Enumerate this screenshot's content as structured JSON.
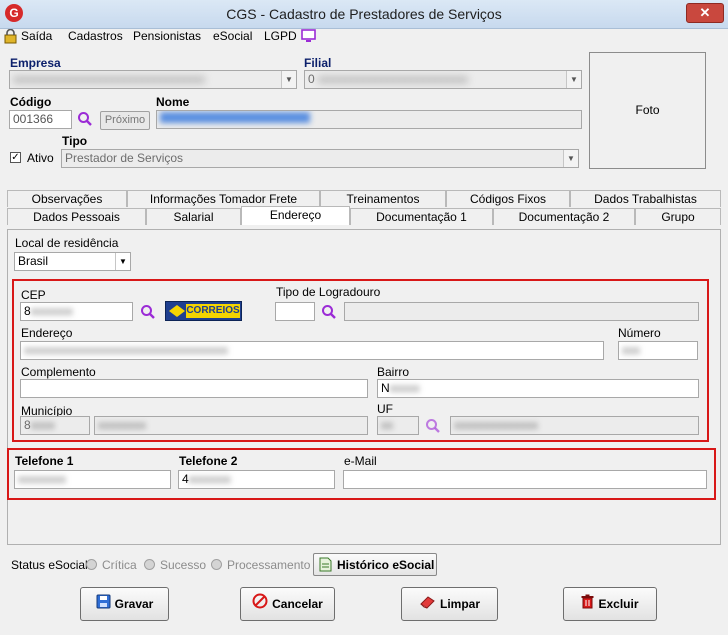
{
  "window": {
    "title": "CGS - Cadastro de Prestadores de Serviços",
    "close_label": "✕",
    "app_icon": "G"
  },
  "menu": {
    "saida": "Saída",
    "cadastros": "Cadastros",
    "pensionistas": "Pensionistas",
    "esocial": "eSocial",
    "lgpd": "LGPD"
  },
  "header": {
    "empresa_label": "Empresa",
    "empresa_value": "",
    "filial_label": "Filial",
    "filial_value": "0",
    "codigo_label": "Código",
    "codigo_value": "001366",
    "proximo_label": "Próximo",
    "nome_label": "Nome",
    "nome_value": "",
    "ativo_label": "Ativo",
    "ativo_checked": "✓",
    "tipo_label": "Tipo",
    "tipo_value": "Prestador de Serviços",
    "foto_label": "Foto"
  },
  "tabs_row1": [
    "Observações",
    "Informações Tomador Frete",
    "Treinamentos",
    "Códigos Fixos",
    "Dados Trabalhistas"
  ],
  "tabs_row2": [
    "Dados Pessoais",
    "Salarial",
    "Endereço",
    "Documentação 1",
    "Documentação 2",
    "Grupo"
  ],
  "endereco": {
    "local_label": "Local de residência",
    "local_value": "Brasil",
    "cep_label": "CEP",
    "cep_value": "8",
    "correios_label": "CORREIOS",
    "tipo_logradouro_label": "Tipo de Logradouro",
    "endereco_label": "Endereço",
    "numero_label": "Número",
    "complemento_label": "Complemento",
    "bairro_label": "Bairro",
    "bairro_value": "N",
    "municipio_label": "Município",
    "municipio_value": "8",
    "uf_label": "UF",
    "telefone1_label": "Telefone 1",
    "telefone2_label": "Telefone 2",
    "telefone2_value": "4",
    "email_label": "e-Mail"
  },
  "status": {
    "label": "Status eSocial:",
    "options": [
      "Crítica",
      "Sucesso",
      "Processamento"
    ],
    "historico_label": "Histórico eSocial"
  },
  "actions": {
    "gravar": "Gravar",
    "cancelar": "Cancelar",
    "limpar": "Limpar",
    "excluir": "Excluir"
  },
  "colors": {
    "highlight": "#d81818",
    "label_blue": "#0b1f6b",
    "accent_purple": "#9b2bd6"
  }
}
